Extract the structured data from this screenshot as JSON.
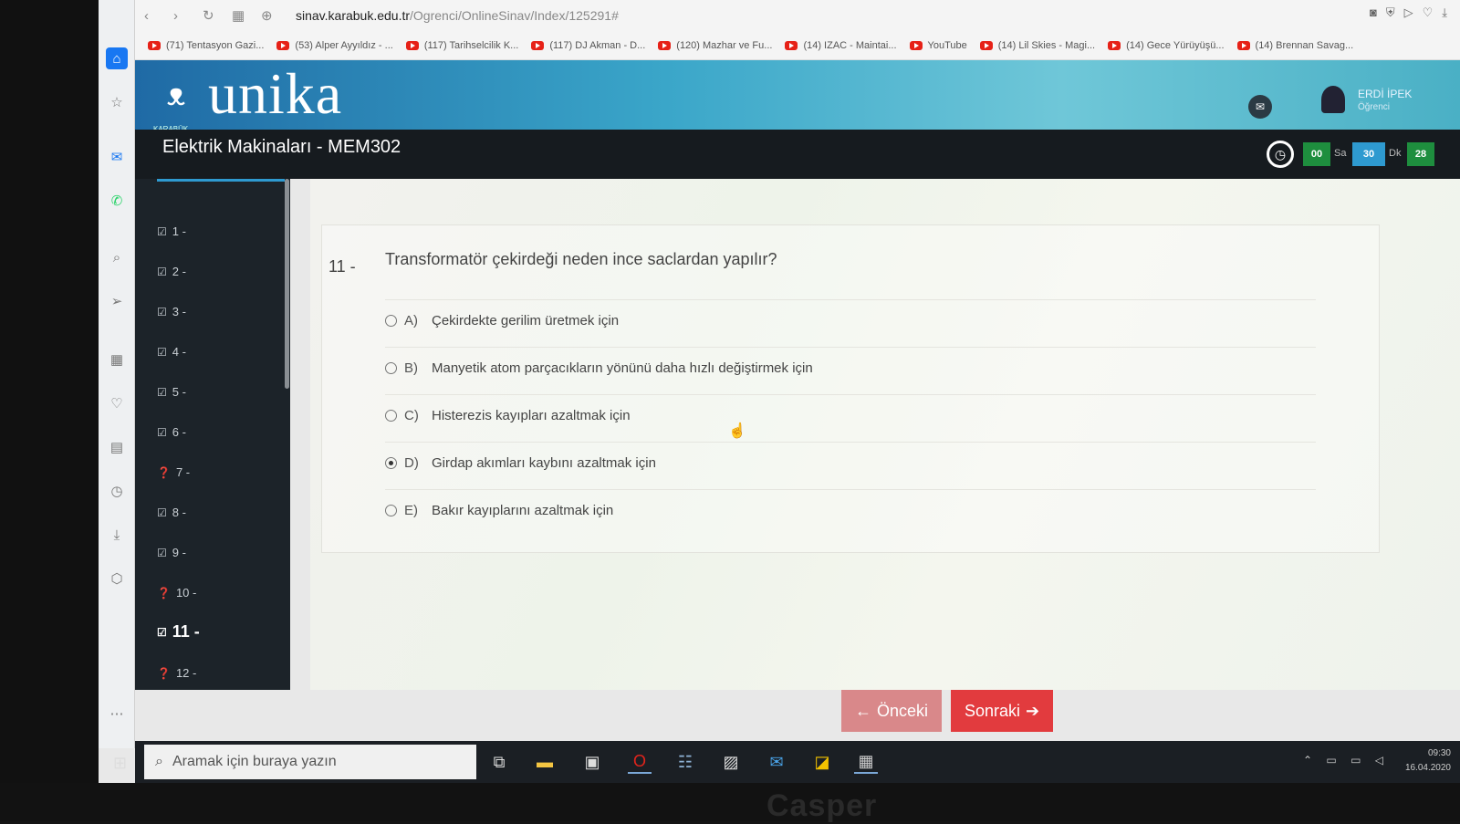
{
  "browser": {
    "url_host": "sinav.karabuk.edu.tr",
    "url_path": "/Ogrenci/OnlineSinav/Index/125291#",
    "bookmarks": [
      "(71) Tentasyon Gazi...",
      "(53) Alper Ayyıldız - ...",
      "(117) Tarihselcilik K...",
      "(117) DJ Akman - D...",
      "(120) Mazhar ve Fu...",
      "(14) IZAC - Maintai...",
      "YouTube",
      "(14) Lil Skies - Magi...",
      "(14) Gece Yürüyüşü...",
      "(14) Brennan Savag..."
    ]
  },
  "header": {
    "logo": "unika",
    "logo_sub": "KARABÜK",
    "user_name": "ERDİ İPEK",
    "user_role": "Öğrenci"
  },
  "course": {
    "title": "Elektrik Makinaları - MEM302",
    "timer": {
      "hours": "00",
      "hours_label": "Sa",
      "minutes": "30",
      "minutes_label": "Dk",
      "seconds": "28"
    }
  },
  "question_nav": [
    {
      "label": "1 -",
      "state": "answered"
    },
    {
      "label": "2 -",
      "state": "answered"
    },
    {
      "label": "3 -",
      "state": "answered"
    },
    {
      "label": "4 -",
      "state": "answered"
    },
    {
      "label": "5 -",
      "state": "answered"
    },
    {
      "label": "6 -",
      "state": "answered"
    },
    {
      "label": "7 -",
      "state": "unanswered"
    },
    {
      "label": "8 -",
      "state": "answered"
    },
    {
      "label": "9 -",
      "state": "answered"
    },
    {
      "label": "10 -",
      "state": "unanswered"
    },
    {
      "label": "11 -",
      "state": "current"
    },
    {
      "label": "12 -",
      "state": "unanswered"
    }
  ],
  "question": {
    "number": "11 -",
    "text": "Transformatör çekirdeği neden ince saclardan yapılır?",
    "options": [
      {
        "letter": "A)",
        "text": "Çekirdekte gerilim üretmek için",
        "selected": false
      },
      {
        "letter": "B)",
        "text": "Manyetik atom parçacıkların yönünü daha hızlı değiştirmek için",
        "selected": false
      },
      {
        "letter": "C)",
        "text": "Histerezis kayıpları azaltmak için",
        "selected": false
      },
      {
        "letter": "D)",
        "text": "Girdap akımları kaybını azaltmak için",
        "selected": true
      },
      {
        "letter": "E)",
        "text": "Bakır kayıplarını azaltmak için",
        "selected": false
      }
    ]
  },
  "buttons": {
    "prev": "Önceki",
    "next": "Sonraki"
  },
  "taskbar": {
    "search_placeholder": "Aramak için buraya yazın",
    "time": "09:30",
    "date": "16.04.2020"
  },
  "monitor_brand": "Casper",
  "colors": {
    "header_accent": "#3aa6c9",
    "next_button": "#e23b3e",
    "timer_hours": "#1e8e3e",
    "timer_minutes": "#2e9ad0",
    "timer_seconds": "#1e8e3e"
  }
}
